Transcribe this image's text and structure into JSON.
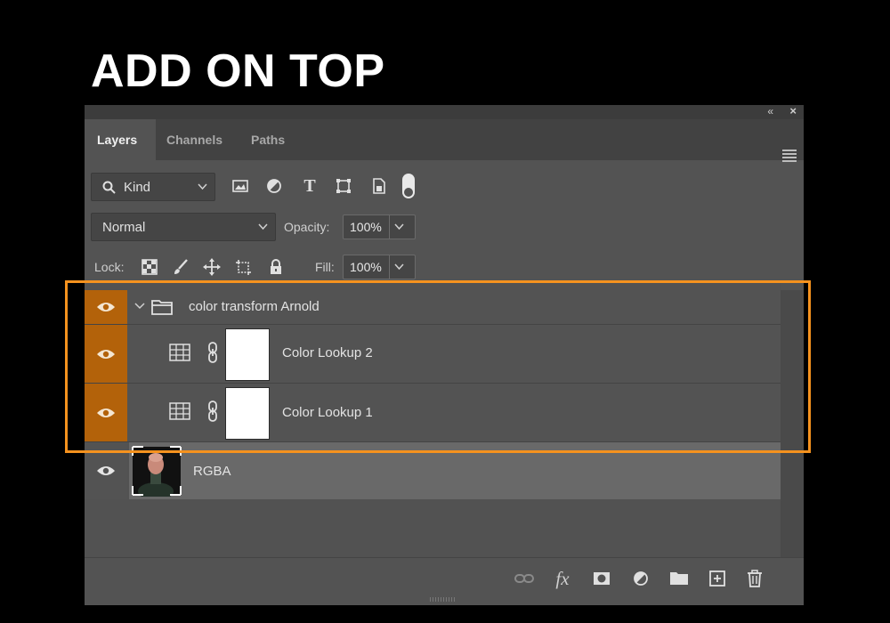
{
  "headline": "ADD ON TOP",
  "panel": {
    "tabs": [
      {
        "label": "Layers",
        "active": true
      },
      {
        "label": "Channels",
        "active": false
      },
      {
        "label": "Paths",
        "active": false
      }
    ],
    "filter": {
      "kind_label": "Kind"
    },
    "blend_mode": "Normal",
    "opacity_label": "Opacity:",
    "opacity_value": "100%",
    "lock_label": "Lock:",
    "fill_label": "Fill:",
    "fill_value": "100%",
    "layers": [
      {
        "name": "color transform Arnold",
        "type": "group",
        "visible": true
      },
      {
        "name": "Color Lookup 2",
        "type": "adjustment",
        "visible": true
      },
      {
        "name": "Color Lookup 1",
        "type": "adjustment",
        "visible": true
      },
      {
        "name": "RGBA",
        "type": "pixel",
        "visible": true,
        "selected": true
      }
    ],
    "colors": {
      "highlight_border": "#f5921e",
      "eye_active": "#b3620a",
      "panel_bg": "#535353"
    }
  }
}
